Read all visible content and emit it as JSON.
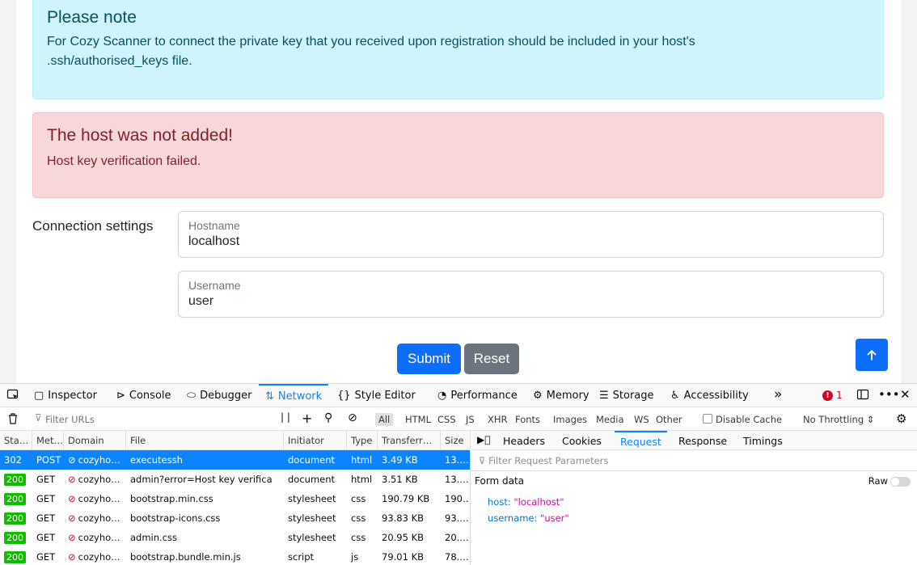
{
  "page": {
    "info_alert": {
      "title": "Please note",
      "body_line1": "For Cozy Scanner to connect the private key that you received upon registration should be included in your host's",
      "body_line2": ".ssh/authorised_keys file."
    },
    "error_alert": {
      "title": "The host was not added!",
      "body": "Host key verification failed."
    },
    "connection_label": "Connection settings",
    "hostname": {
      "label": "Hostname",
      "value": "localhost"
    },
    "username": {
      "label": "Username",
      "value": "user"
    },
    "submit_label": "Submit",
    "reset_label": "Reset",
    "back_to_top_icon": "arrow-up-icon"
  },
  "devtools": {
    "tabs": [
      {
        "label": "Inspector",
        "icon": "inspector-icon"
      },
      {
        "label": "Console",
        "icon": "console-icon"
      },
      {
        "label": "Debugger",
        "icon": "debugger-icon"
      },
      {
        "label": "Network",
        "icon": "network-icon",
        "active": true
      },
      {
        "label": "Style Editor",
        "icon": "style-editor-icon"
      },
      {
        "label": "Performance",
        "icon": "performance-icon"
      },
      {
        "label": "Memory",
        "icon": "memory-icon"
      },
      {
        "label": "Storage",
        "icon": "storage-icon"
      },
      {
        "label": "Accessibility",
        "icon": "accessibility-icon"
      }
    ],
    "error_count": "1",
    "filter_placeholder": "Filter URLs",
    "type_filters": [
      "All",
      "HTML",
      "CSS",
      "JS",
      "XHR",
      "Fonts",
      "Images",
      "Media",
      "WS",
      "Other"
    ],
    "disable_cache_label": "Disable Cache",
    "throttling_label": "No Throttling",
    "columns": [
      "Sta…",
      "Met…",
      "Domain",
      "File",
      "Initiator",
      "Type",
      "Transferr…",
      "Size"
    ],
    "requests": [
      {
        "status": "302",
        "method": "POST",
        "domain": "cozyho…",
        "file": "executessh",
        "initiator": "document",
        "type": "html",
        "transferred": "3.49 KB",
        "size": "13.…",
        "selected": true
      },
      {
        "status": "200",
        "method": "GET",
        "domain": "cozyho…",
        "file": "admin?error=Host key verifica",
        "initiator": "document",
        "type": "html",
        "transferred": "3.51 KB",
        "size": "13.…"
      },
      {
        "status": "200",
        "method": "GET",
        "domain": "cozyho…",
        "file": "bootstrap.min.css",
        "initiator": "stylesheet",
        "type": "css",
        "transferred": "190.79 KB",
        "size": "190…"
      },
      {
        "status": "200",
        "method": "GET",
        "domain": "cozyho…",
        "file": "bootstrap-icons.css",
        "initiator": "stylesheet",
        "type": "css",
        "transferred": "93.83 KB",
        "size": "93.…"
      },
      {
        "status": "200",
        "method": "GET",
        "domain": "cozyho…",
        "file": "admin.css",
        "initiator": "stylesheet",
        "type": "css",
        "transferred": "20.95 KB",
        "size": "20.…"
      },
      {
        "status": "200",
        "method": "GET",
        "domain": "cozyho…",
        "file": "bootstrap.bundle.min.js",
        "initiator": "script",
        "type": "js",
        "transferred": "79.01 KB",
        "size": "78.…"
      }
    ],
    "detail_tabs": [
      "Headers",
      "Cookies",
      "Request",
      "Response",
      "Timings"
    ],
    "detail_active": "Request",
    "param_filter_placeholder": "Filter Request Parameters",
    "form_data_label": "Form data",
    "raw_label": "Raw",
    "form_data": [
      {
        "key": "host:",
        "value": "\"localhost\""
      },
      {
        "key": "username:",
        "value": "\"user\""
      }
    ]
  },
  "colors": {
    "primary": "#0d6efd",
    "secondary": "#6c757d",
    "info_bg": "#cff4fc",
    "danger_bg": "#f8d7da",
    "devtools_accent": "#0a84ff"
  }
}
